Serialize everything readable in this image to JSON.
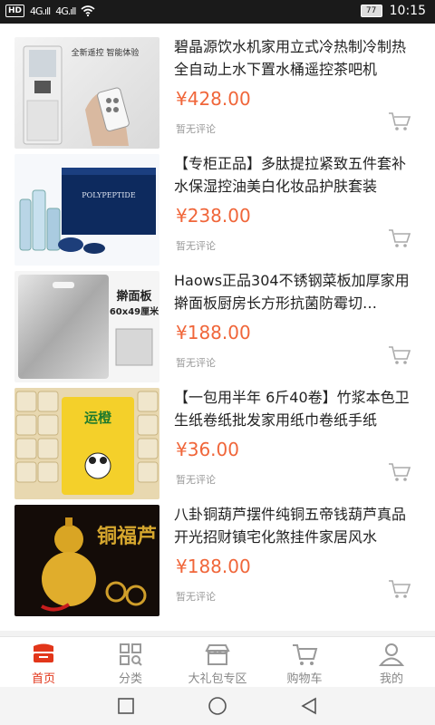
{
  "status_bar": {
    "network": "HD",
    "signal1": "4G.ıll",
    "signal2": "4G.ıll",
    "battery": "77",
    "time": "10:15"
  },
  "products": [
    {
      "title": "碧晶源饮水机家用立式冷热制冷制热全自动上水下置水桶遥控茶吧机",
      "price": "¥428.00",
      "review": "暂无评论",
      "image_caption": "全新遥控 智能体验"
    },
    {
      "title": "【专柜正品】多肽提拉紧致五件套补水保湿控油美白化妆品护肤套装",
      "price": "¥238.00",
      "review": "暂无评论",
      "image_caption": "POLYPEPTIDE"
    },
    {
      "title": "Haows正品304不锈钢菜板加厚家用擀面板厨房长方形抗菌防霉切…",
      "price": "¥188.00",
      "review": "暂无评论",
      "image_caption": "擀面板",
      "image_size": "60x49厘米"
    },
    {
      "title": "【一包用半年 6斤40卷】竹浆本色卫生纸卷纸批发家用纸巾卷纸手纸",
      "price": "¥36.00",
      "review": "暂无评论",
      "image_caption": "运橙"
    },
    {
      "title": "八卦铜葫芦摆件纯铜五帝钱葫芦真品开光招财镇宅化煞挂件家居风水",
      "price": "¥188.00",
      "review": "暂无评论",
      "image_caption": "铜福芦"
    }
  ],
  "nav": [
    {
      "label": "首页",
      "icon": "home-icon",
      "active": true
    },
    {
      "label": "分类",
      "icon": "category-icon"
    },
    {
      "label": "大礼包专区",
      "icon": "gift-shop-icon"
    },
    {
      "label": "购物车",
      "icon": "cart-icon"
    },
    {
      "label": "我的",
      "icon": "user-icon"
    }
  ],
  "colors": {
    "price": "#f0663a",
    "active_nav": "#e2361a",
    "review": "#999999"
  }
}
